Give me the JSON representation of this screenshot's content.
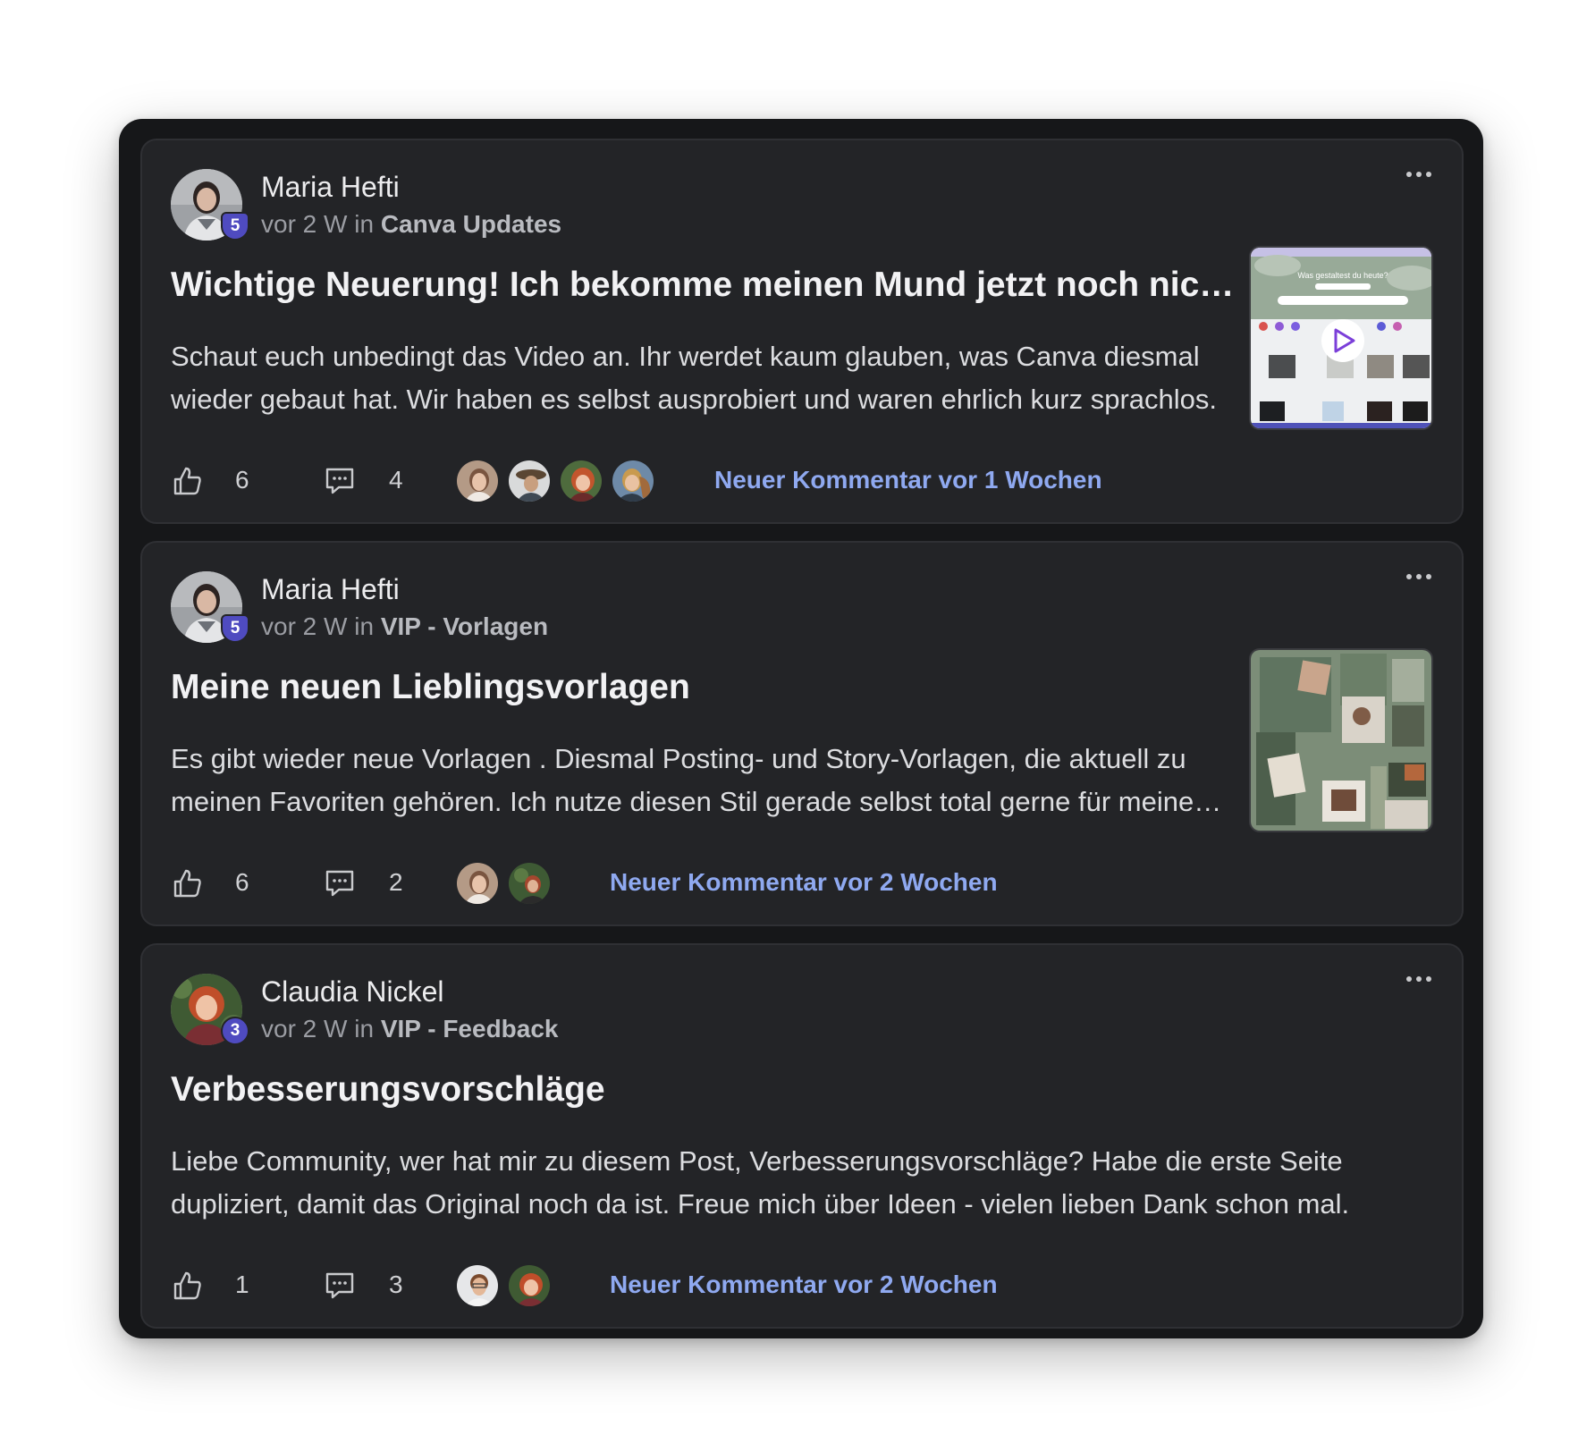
{
  "posts": [
    {
      "author": "Maria Hefti",
      "level": "5",
      "time": "vor 2 W in",
      "space": "Canva Updates",
      "title": "Wichtige Neuerung! Ich bekomme meinen Mund jetzt noch nicht mehr zu",
      "excerpt": "Schaut euch unbedingt das Video an. Ihr werdet kaum glauben, was Canva diesmal wieder gebaut hat. Wir haben es selbst ausprobiert und waren ehrlich kurz sprachlos.",
      "likes": "6",
      "comments": "4",
      "new_comment": "Neuer Kommentar vor 1 Wochen",
      "thumbnail_text": "Was gestaltest du heute?",
      "thumbnail_icon": "play-icon",
      "commenter_count": 4
    },
    {
      "author": "Maria Hefti",
      "level": "5",
      "time": "vor 2 W in",
      "space": "VIP - Vorlagen",
      "title": "Meine neuen Lieblingsvorlagen",
      "excerpt": "Es gibt wieder neue Vorlagen . Diesmal Posting- und Story-Vorlagen, die aktuell zu meinen Favoriten gehören. Ich nutze diesen Stil gerade selbst total gerne für meine Beiträge.",
      "likes": "6",
      "comments": "2",
      "new_comment": "Neuer Kommentar vor 2 Wochen",
      "thumbnail_icon": "template-collage",
      "commenter_count": 2
    },
    {
      "author": "Claudia Nickel",
      "level": "3",
      "time": "vor 2 W in",
      "space": "VIP - Feedback",
      "title": "Verbesserungsvorschläge",
      "excerpt": "Liebe Community, wer hat mir zu diesem Post, Verbesserungsvorschläge? Habe die erste Seite dupliziert, damit das Original noch da ist. Freue mich über Ideen - vielen lieben Dank schon mal.",
      "likes": "1",
      "comments": "3",
      "new_comment": "Neuer Kommentar vor 2 Wochen",
      "commenter_count": 2
    }
  ],
  "icons": {
    "like": "thumbs-up-icon",
    "comment": "comment-bubble-icon",
    "more": "more-horizontal-icon"
  },
  "colors": {
    "background": "#161719",
    "card": "#232427",
    "accent_link": "#8fa9f0",
    "level_badge": "#4f4bc0"
  }
}
